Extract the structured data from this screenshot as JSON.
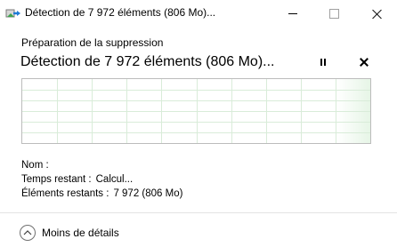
{
  "window": {
    "title": "Détection de 7 972 éléments (806 Mo)...",
    "icon": "delete-files-icon",
    "minimize_icon": "minimize-icon",
    "maximize_icon": "maximize-icon",
    "close_icon": "close-icon"
  },
  "operation": {
    "subtitle": "Préparation de la suppression",
    "title": "Détection de 7 972 éléments (806 Mo)...",
    "pause_icon": "pause-icon",
    "cancel_icon": "cancel-icon",
    "progress_fraction": 0.04,
    "graph_color": "#06b025",
    "grid_color": "#d9ecd9"
  },
  "details": {
    "name_label": "Nom :",
    "name_value": "",
    "time_label": "Temps restant :",
    "time_value": "Calcul...",
    "items_label": "Éléments restants :",
    "items_value": "7 972 (806 Mo)"
  },
  "footer": {
    "toggle_label": "Moins de détails",
    "toggle_icon": "chevron-up-icon"
  }
}
